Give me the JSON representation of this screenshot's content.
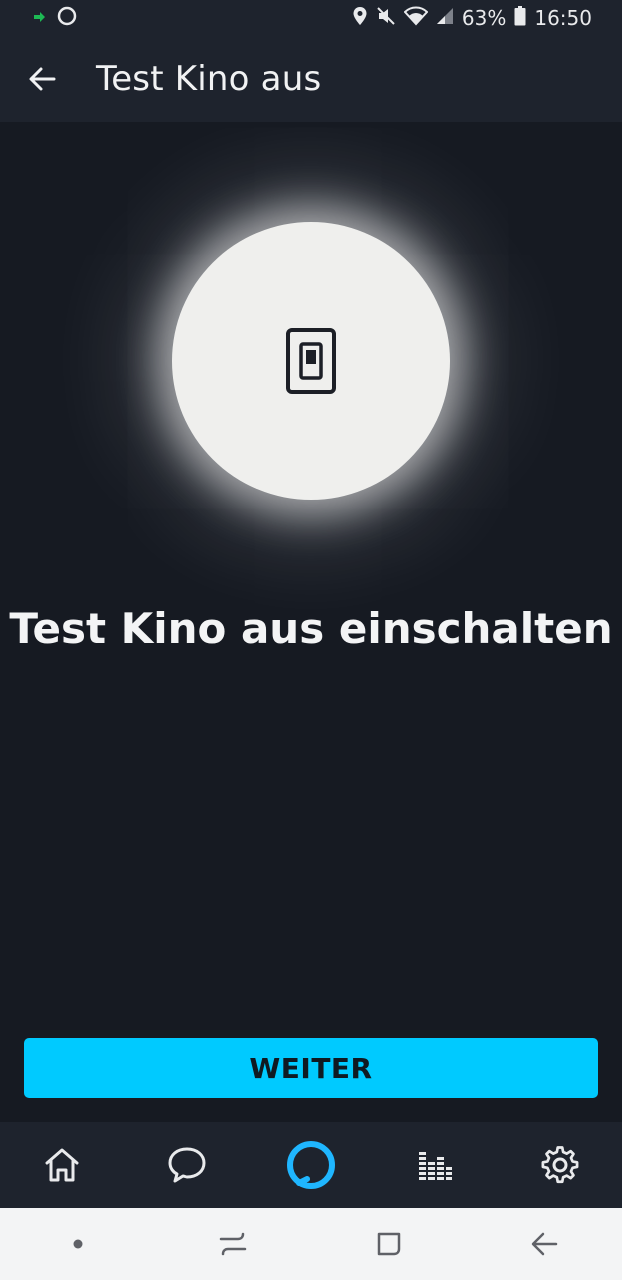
{
  "status_bar": {
    "battery_percent": "63%",
    "time": "16:50"
  },
  "app_bar": {
    "title": "Test Kino aus"
  },
  "main": {
    "headline": "Test Kino aus einschalten",
    "continue_button": "WEITER"
  },
  "bottom_nav": {
    "items": [
      "home-icon",
      "chat-icon",
      "alexa-icon",
      "music-icon",
      "gear-icon"
    ],
    "alexa_color": "#1fb6ff"
  },
  "colors": {
    "background": "#161a22",
    "bar": "#1e232d",
    "accent": "#00caff",
    "circle": "#efefed"
  }
}
